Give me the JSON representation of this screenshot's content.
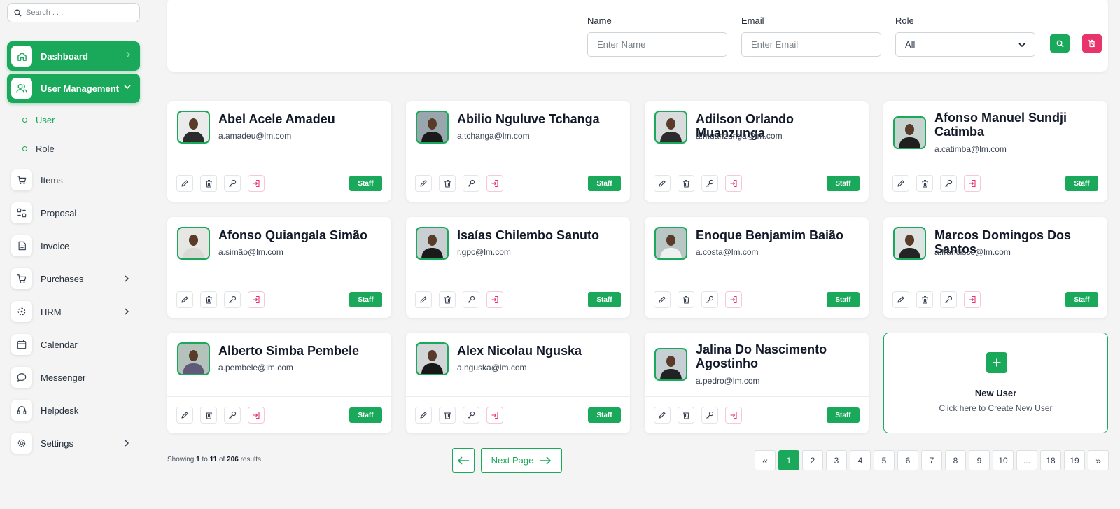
{
  "search": {
    "placeholder": "Search . . ."
  },
  "sidebar": {
    "dashboard": "Dashboard",
    "user_management": "User Management",
    "sub": [
      {
        "label": "User"
      },
      {
        "label": "Role"
      }
    ],
    "items": [
      {
        "label": "Items"
      },
      {
        "label": "Proposal"
      },
      {
        "label": "Invoice"
      },
      {
        "label": "Purchases"
      },
      {
        "label": "HRM"
      },
      {
        "label": "Calendar"
      },
      {
        "label": "Messenger"
      },
      {
        "label": "Helpdesk"
      },
      {
        "label": "Settings"
      }
    ]
  },
  "filter": {
    "name_label": "Name",
    "name_placeholder": "Enter Name",
    "email_label": "Email",
    "email_placeholder": "Enter Email",
    "role_label": "Role",
    "role_value": "All"
  },
  "users": [
    {
      "name": "Abel Acele Amadeu",
      "email": "a.amadeu@lm.com",
      "role": "Staff"
    },
    {
      "name": "Abilio Nguluve Tchanga",
      "email": "a.tchanga@lm.com",
      "role": "Staff"
    },
    {
      "name": "Adilson Orlando Muanzunga",
      "email": "a.muanzunga@lm.com",
      "role": "Staff"
    },
    {
      "name": "Afonso Manuel Sundji Catimba",
      "email": "a.catimba@lm.com",
      "role": "Staff"
    },
    {
      "name": "Afonso Quiangala Simão",
      "email": "a.simão@lm.com",
      "role": "Staff"
    },
    {
      "name": "Isaías Chilembo Sanuto",
      "email": "r.gpc@lm.com",
      "role": "Staff"
    },
    {
      "name": "Enoque Benjamim Baião",
      "email": "a.costa@lm.com",
      "role": "Staff"
    },
    {
      "name": "Marcos Domingos Dos Santos",
      "email": "a.francisco@lm.com",
      "role": "Staff"
    },
    {
      "name": "Alberto Simba Pembele",
      "email": "a.pembele@lm.com",
      "role": "Staff"
    },
    {
      "name": "Alex Nicolau Nguska",
      "email": "a.nguska@lm.com",
      "role": "Staff"
    },
    {
      "name": "Jalina Do Nascimento Agostinho",
      "email": "a.pedro@lm.com",
      "role": "Staff"
    }
  ],
  "new_user": {
    "title": "New User",
    "subtitle": "Click here to Create New User"
  },
  "pagination": {
    "showing_prefix": "Showing",
    "from": "1",
    "to_word": "to",
    "to": "11",
    "of_word": "of",
    "total": "206",
    "suffix": "results",
    "next_label": "Next Page",
    "first": "«",
    "last": "»",
    "pages": [
      "1",
      "2",
      "3",
      "4",
      "5",
      "6",
      "7",
      "8",
      "9",
      "10",
      "...",
      "18",
      "19"
    ],
    "current": "1"
  },
  "colors": {
    "accent": "#1aa85a",
    "danger": "#e9336b"
  }
}
